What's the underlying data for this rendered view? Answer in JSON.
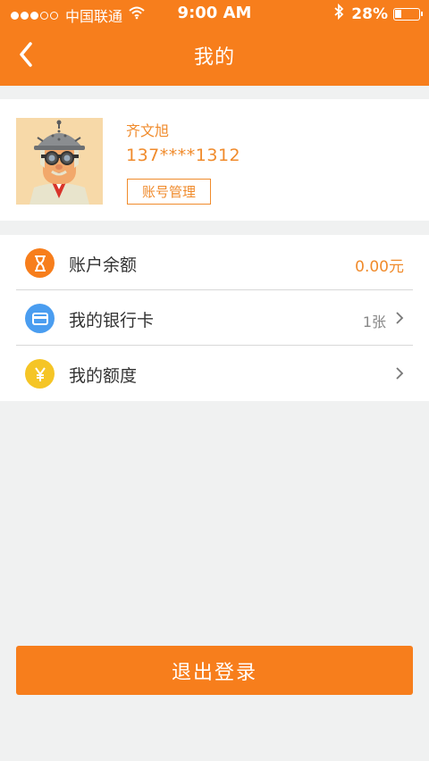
{
  "status_bar": {
    "carrier": "中国联通",
    "time": "9:00 AM",
    "battery": "28%",
    "battery_level": 0.28
  },
  "header": {
    "title": "我的"
  },
  "profile": {
    "name": "齐文旭",
    "phone": "137****1312",
    "account_button": "账号管理"
  },
  "menu": {
    "balance": {
      "label": "账户余额",
      "value": "0.00元",
      "icon": "hourglass-icon",
      "color": "#f77e1c"
    },
    "bank_card": {
      "label": "我的银行卡",
      "value": "1张",
      "icon": "card-icon",
      "color": "#4a9df0"
    },
    "quota": {
      "label": "我的额度",
      "icon": "yen-icon",
      "color": "#f5c526"
    }
  },
  "logout": {
    "label": "退出登录"
  },
  "colors": {
    "brand": "#f77e1c",
    "text_accent": "#f08b2c",
    "background": "#f0f1f1"
  }
}
